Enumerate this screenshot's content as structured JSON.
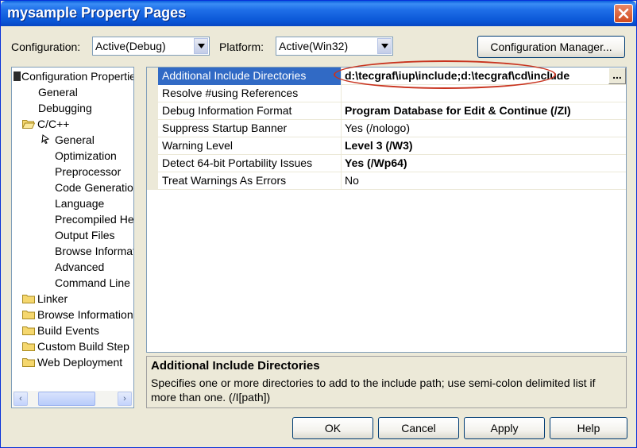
{
  "window": {
    "title": "mysample Property Pages"
  },
  "toolbar": {
    "configuration_label": "Configuration:",
    "configuration_value": "Active(Debug)",
    "platform_label": "Platform:",
    "platform_value": "Active(Win32)",
    "config_manager_label": "Configuration Manager..."
  },
  "tree": {
    "items": [
      {
        "label": "Configuration Properties",
        "level": 0,
        "icon": "open-folder-icon"
      },
      {
        "label": "General",
        "level": 1
      },
      {
        "label": "Debugging",
        "level": 1
      },
      {
        "label": "C/C++",
        "level": 1,
        "icon": "open-folder-icon"
      },
      {
        "label": "General",
        "level": 2,
        "selected_marker": true
      },
      {
        "label": "Optimization",
        "level": 2
      },
      {
        "label": "Preprocessor",
        "level": 2
      },
      {
        "label": "Code Generation",
        "level": 2
      },
      {
        "label": "Language",
        "level": 2
      },
      {
        "label": "Precompiled Headers",
        "level": 2
      },
      {
        "label": "Output Files",
        "level": 2
      },
      {
        "label": "Browse Information",
        "level": 2
      },
      {
        "label": "Advanced",
        "level": 2
      },
      {
        "label": "Command Line",
        "level": 2
      },
      {
        "label": "Linker",
        "level": 1,
        "icon": "folder-icon"
      },
      {
        "label": "Browse Information",
        "level": 1,
        "icon": "folder-icon"
      },
      {
        "label": "Build Events",
        "level": 1,
        "icon": "folder-icon"
      },
      {
        "label": "Custom Build Step",
        "level": 1,
        "icon": "folder-icon"
      },
      {
        "label": "Web Deployment",
        "level": 1,
        "icon": "folder-icon"
      }
    ]
  },
  "properties": [
    {
      "name": "Additional Include Directories",
      "value": "d:\\tecgraf\\iup\\include;d:\\tecgraf\\cd\\include",
      "bold": true,
      "selected": true
    },
    {
      "name": "Resolve #using References",
      "value": "",
      "bold": false
    },
    {
      "name": "Debug Information Format",
      "value": "Program Database for Edit & Continue (/ZI)",
      "bold": true
    },
    {
      "name": "Suppress Startup Banner",
      "value": "Yes (/nologo)",
      "bold": false
    },
    {
      "name": "Warning Level",
      "value": "Level 3 (/W3)",
      "bold": true
    },
    {
      "name": "Detect 64-bit Portability Issues",
      "value": "Yes (/Wp64)",
      "bold": true
    },
    {
      "name": "Treat Warnings As Errors",
      "value": "No",
      "bold": false
    }
  ],
  "description": {
    "title": "Additional Include Directories",
    "text": "Specifies one or more directories to add to the include path; use semi-colon delimited list if more than one.     (/I[path])"
  },
  "buttons": {
    "ok": "OK",
    "cancel": "Cancel",
    "apply": "Apply",
    "help": "Help"
  },
  "colors": {
    "selection": "#316ac5",
    "annotation_oval": "#c8331e",
    "titlebar": "#0a56d6"
  }
}
